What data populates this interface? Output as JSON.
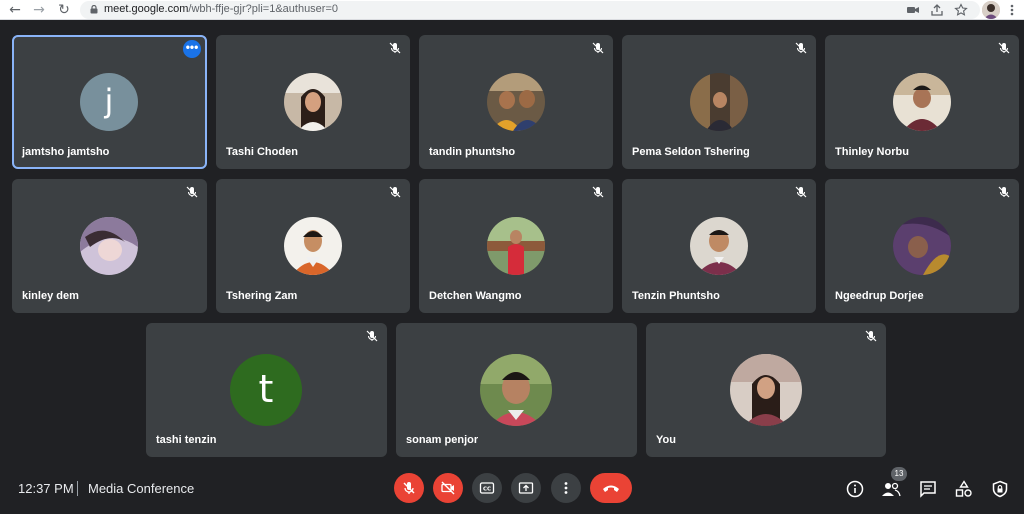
{
  "browser": {
    "url_host": "meet.google.com",
    "url_path": "/wbh-ffje-gjr?pli=1&authuser=0"
  },
  "participants": [
    {
      "name": "jamtsho jamtsho",
      "avatar_letter": "j",
      "avatar_color": "#78909c",
      "active": true
    },
    {
      "name": "Tashi Choden"
    },
    {
      "name": "tandin phuntsho"
    },
    {
      "name": "Pema Seldon Tshering"
    },
    {
      "name": "Thinley Norbu"
    },
    {
      "name": "kinley dem"
    },
    {
      "name": "Tshering Zam"
    },
    {
      "name": "Detchen Wangmo"
    },
    {
      "name": "Tenzin Phuntsho"
    },
    {
      "name": "Ngeedrup Dorjee"
    },
    {
      "name": "tashi tenzin",
      "avatar_letter": "t",
      "avatar_color": "#2e6b1f"
    },
    {
      "name": "sonam penjor"
    },
    {
      "name": "You"
    }
  ],
  "footer": {
    "time": "12:37 PM",
    "meeting_title": "Media Conference",
    "participant_count": "13"
  },
  "colors": {
    "background": "#202124",
    "tile": "#3c4043",
    "danger": "#ea4335",
    "accent": "#1a73e8"
  }
}
